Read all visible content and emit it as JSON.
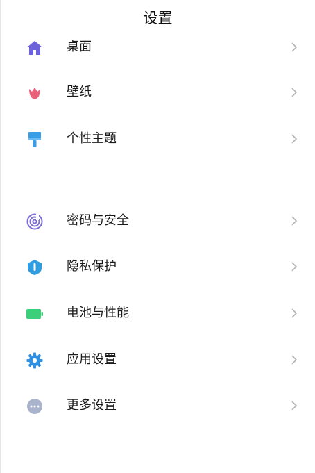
{
  "header": {
    "title": "设置"
  },
  "items": [
    {
      "label": "桌面",
      "icon": "home-icon",
      "color": "#6c63d9"
    },
    {
      "label": "壁纸",
      "icon": "tulip-icon",
      "color": "#e8607a"
    },
    {
      "label": "个性主题",
      "icon": "paint-brush-icon",
      "color": "#3a9ee6"
    },
    {
      "label": "密码与安全",
      "icon": "fingerprint-icon",
      "color": "#7b6fd6"
    },
    {
      "label": "隐私保护",
      "icon": "shield-icon",
      "color": "#2f9de0"
    },
    {
      "label": "电池与性能",
      "icon": "battery-icon",
      "color": "#3ccf7a"
    },
    {
      "label": "应用设置",
      "icon": "gear-icon",
      "color": "#2f8fe0"
    },
    {
      "label": "更多设置",
      "icon": "more-dots-icon",
      "color": "#aab3cc"
    }
  ]
}
